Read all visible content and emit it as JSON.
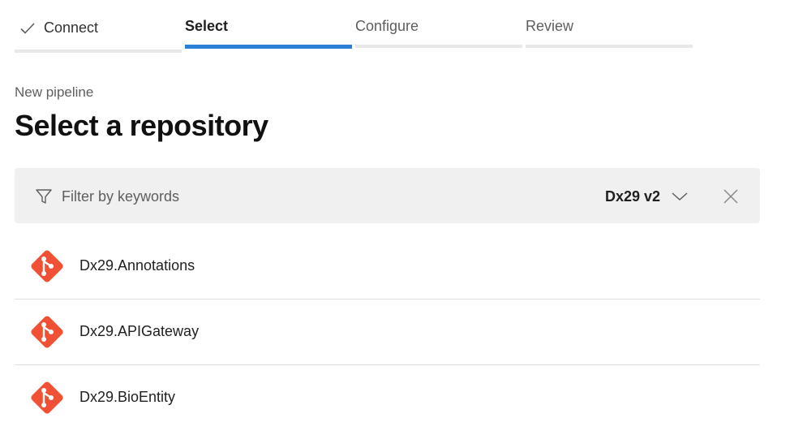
{
  "wizard": {
    "steps": [
      {
        "label": "Connect",
        "state": "completed"
      },
      {
        "label": "Select",
        "state": "active"
      },
      {
        "label": "Configure",
        "state": "pending"
      },
      {
        "label": "Review",
        "state": "pending"
      }
    ],
    "active_color": "#2b7fd6"
  },
  "header": {
    "subtitle": "New pipeline",
    "title": "Select a repository"
  },
  "filter": {
    "placeholder": "Filter by keywords",
    "value": "",
    "organization": "Dx29 v2",
    "filter_icon": "filter-icon",
    "chevron_icon": "chevron-down-icon",
    "clear_icon": "close-icon"
  },
  "repos": {
    "icon": "git-repo-icon",
    "icon_color": "#f05033",
    "items": [
      {
        "name": "Dx29.Annotations"
      },
      {
        "name": "Dx29.APIGateway"
      },
      {
        "name": "Dx29.BioEntity"
      }
    ]
  }
}
